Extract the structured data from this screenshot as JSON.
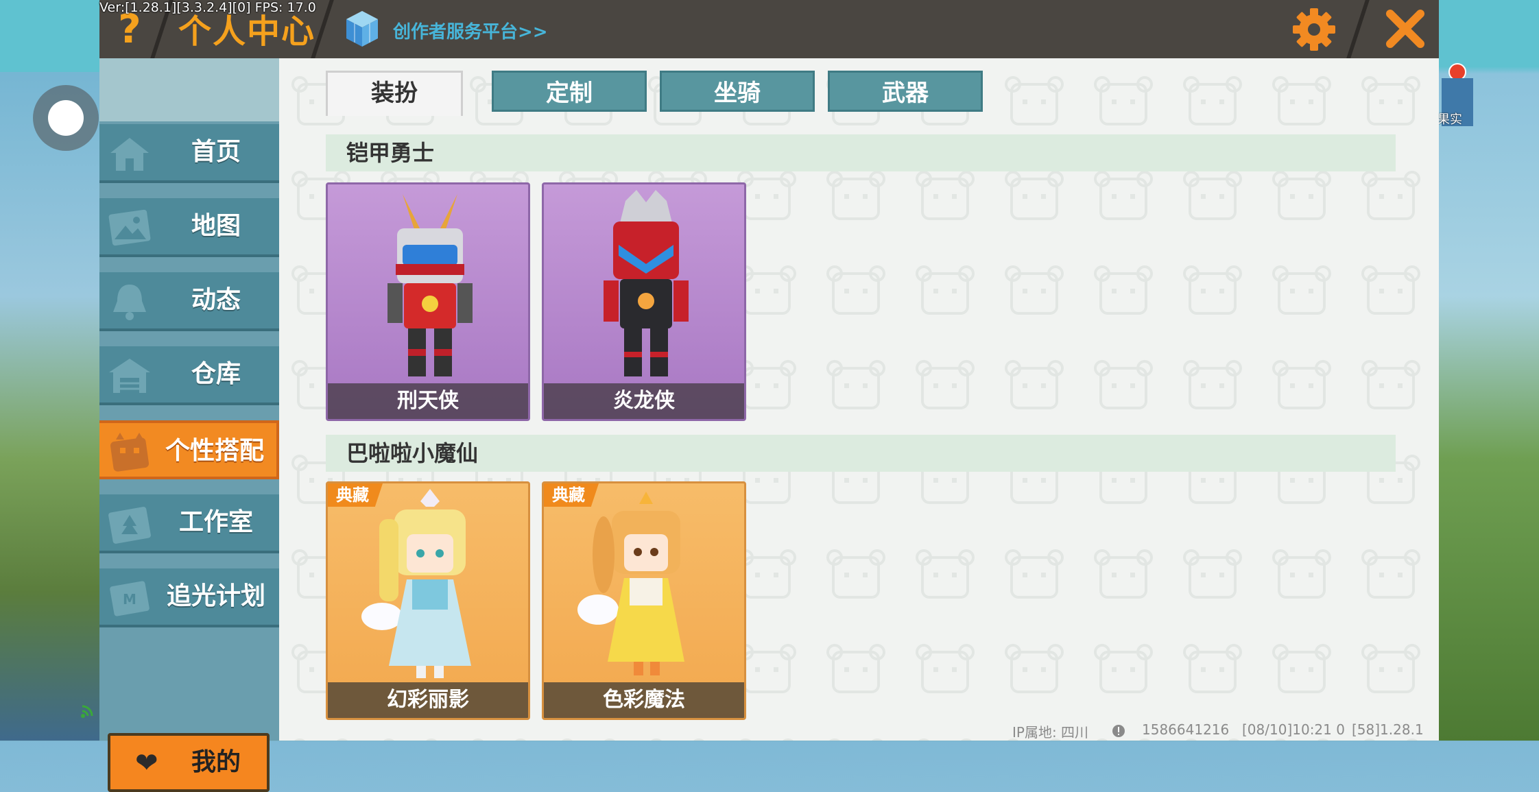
{
  "debug": {
    "fps_text": "Ver:[1.28.1][3.3.2.4][0] FPS: 17.0"
  },
  "header": {
    "title": "个人中心",
    "help_glyph": "?",
    "creator_link": "创作者服务平台>>"
  },
  "side": {
    "label": "果实"
  },
  "sidebar": {
    "items": [
      {
        "label": "首页",
        "icon": "home-icon"
      },
      {
        "label": "地图",
        "icon": "map-icon"
      },
      {
        "label": "动态",
        "icon": "bell-icon"
      },
      {
        "label": "仓库",
        "icon": "warehouse-icon"
      },
      {
        "label": "个性搭配",
        "icon": "outfit-icon",
        "active": true
      },
      {
        "label": "工作室",
        "icon": "studio-icon"
      },
      {
        "label": "追光计划",
        "icon": "chase-light-icon"
      }
    ],
    "mine_label": "我的"
  },
  "tabs": [
    {
      "label": "装扮",
      "active": true
    },
    {
      "label": "定制"
    },
    {
      "label": "坐骑"
    },
    {
      "label": "武器"
    }
  ],
  "sections": [
    {
      "title": "铠甲勇士",
      "cards": [
        {
          "name": "刑天侠",
          "style": "purple"
        },
        {
          "name": "炎龙侠",
          "style": "purple"
        }
      ]
    },
    {
      "title": "巴啦啦小魔仙",
      "cards": [
        {
          "name": "幻彩丽影",
          "style": "orange",
          "badge": "典藏"
        },
        {
          "name": "色彩魔法",
          "style": "orange",
          "badge": "典藏"
        }
      ]
    }
  ],
  "footer": {
    "ip_location": "IP属地: 四川",
    "user_id": "1586641216",
    "timestamp": "[08/10]10:21 0",
    "version": "[58]1.28.1"
  },
  "colors": {
    "accent_orange": "#f5a11d",
    "tab_teal": "#58969f",
    "sidebar_teal": "#4e8a9a",
    "active_orange": "#f28a22",
    "link_blue": "#47b5d9"
  }
}
